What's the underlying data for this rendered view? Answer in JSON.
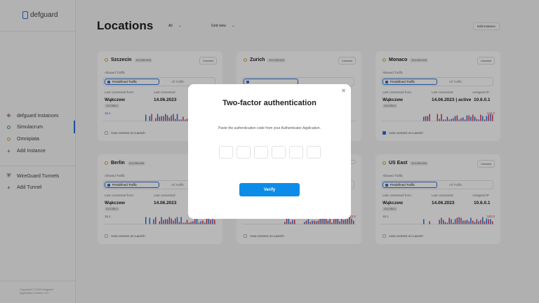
{
  "app": {
    "name": "defguard"
  },
  "sidebar": {
    "instances_header": "defguard Instances",
    "instances": [
      {
        "label": "Simulacrum",
        "status": "green",
        "active": true
      },
      {
        "label": "Omnipiata",
        "status": "yellow",
        "active": false
      }
    ],
    "add_instance": "Add Instance",
    "tunnels_header": "WireGuard Tunnels",
    "add_tunnel": "Add Tunnel",
    "copyright": "Copyright © 2023 defguard",
    "version": "Application version: 0.0"
  },
  "header": {
    "title": "Locations",
    "filter_value": "All",
    "view_value": "Grid view",
    "edit_button": "Edit instance"
  },
  "cards": [
    {
      "name": "Szczecin",
      "ip": "10.0.254.0/24",
      "connect": "Connect",
      "allowed_label": "Allowed Traffic",
      "predefined": "Predefined Traffic",
      "all": "All Traffic",
      "last_from_label": "Last connected from:",
      "last_label": "Last connected",
      "from_value": "Wąkczew",
      "from_ip": "10.0.254.0",
      "date": "14.06.2023",
      "up": "16.1",
      "down": "",
      "auto": "Auto-connect on Launch",
      "auto_on": false,
      "assigned_label": "",
      "assigned": ""
    },
    {
      "name": "Zurich",
      "ip": "10.0.254.0/24",
      "connect": "Connect",
      "allowed_label": "",
      "predefined": "",
      "all": "",
      "last_from_label": "",
      "last_label": "",
      "from_value": "",
      "from_ip": "",
      "date": "",
      "up": "",
      "down": "",
      "auto": "",
      "auto_on": false,
      "assigned_label": "",
      "assigned": ""
    },
    {
      "name": "Monaco",
      "ip": "10.0.254.0/24",
      "connect": "Connect",
      "allowed_label": "Allowed Traffic",
      "predefined": "Predefined Traffic",
      "all": "All Traffic",
      "last_from_label": "Last connected from:",
      "last_label": "Last connected",
      "from_value": "Wąkczew",
      "from_ip": "10.0.254.0",
      "date": "14.06.2023 | active",
      "up": "",
      "down": "122.0",
      "auto": "Auto-connect on Launch",
      "auto_on": true,
      "assigned_label": "Assigned IP",
      "assigned": "10.6.0.1"
    },
    {
      "name": "Berlin",
      "ip": "10.0.254.0/24",
      "connect": "",
      "allowed_label": "Allowed Traffic",
      "predefined": "Predefined Traffic",
      "all": "All Traffic",
      "last_from_label": "Last connected from:",
      "last_label": "Last connected",
      "from_value": "Wąkczew",
      "from_ip": "10.0.254.0",
      "date": "14.06.2023",
      "up": "16.1",
      "down": "",
      "auto": "Auto-connect on Launch",
      "auto_on": false,
      "assigned_label": "",
      "assigned": ""
    },
    {
      "name": "",
      "ip": "",
      "connect": "",
      "allowed_label": "",
      "predefined": "",
      "all": "",
      "last_from_label": "",
      "last_label": "",
      "from_value": "",
      "from_ip": "",
      "date": "",
      "up": "16.1",
      "down": "122.0",
      "auto": "Auto-connect on Launch",
      "auto_on": false,
      "assigned_label": "",
      "assigned": ""
    },
    {
      "name": "US East",
      "ip": "10.0.254.0/24",
      "connect": "Connect",
      "allowed_label": "Allowed Traffic",
      "predefined": "Predefined Traffic",
      "all": "All Traffic",
      "last_from_label": "Last connected from:",
      "last_label": "Last connected",
      "from_value": "Wąkczew",
      "from_ip": "10.0.254.0",
      "date": "14.06.2023",
      "up": "16.1",
      "down": "122.0",
      "auto": "Auto-connect on Launch",
      "auto_on": false,
      "assigned_label": "Assigned IP",
      "assigned": "10.6.0.1"
    }
  ],
  "modal": {
    "title": "Two-factor authentication",
    "description": "Paste the authentication code from your Authenticator Application.",
    "code_digits": [
      "",
      "",
      "",
      "",
      "",
      ""
    ],
    "verify_button": "Verify"
  },
  "colors": {
    "accent": "#0c8ce9",
    "primary": "#2f6fdc",
    "download": "#d8364b",
    "upload": "#2f6fdc",
    "overlay": "rgba(0,0,0,0.28)"
  },
  "icons": {
    "close": "close-icon",
    "instances": "network-icon",
    "tunnels": "shield-icon",
    "add": "plus-icon",
    "chevron": "chevron-down-icon"
  }
}
